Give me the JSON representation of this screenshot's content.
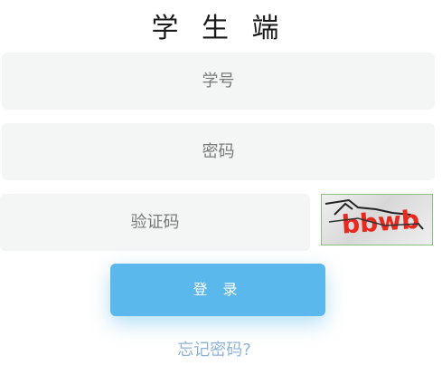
{
  "header": {
    "title": "学 生 端"
  },
  "form": {
    "student_id_placeholder": "学号",
    "password_placeholder": "密码",
    "captcha_placeholder": "验证码",
    "captcha_text": "bbwb",
    "login_label": "登 录",
    "forgot_label": "忘记密码?"
  },
  "colors": {
    "accent": "#5bb8ec",
    "link": "#8db3d9",
    "field_bg": "#f4f5f5",
    "captcha_text": "#e8291f"
  }
}
